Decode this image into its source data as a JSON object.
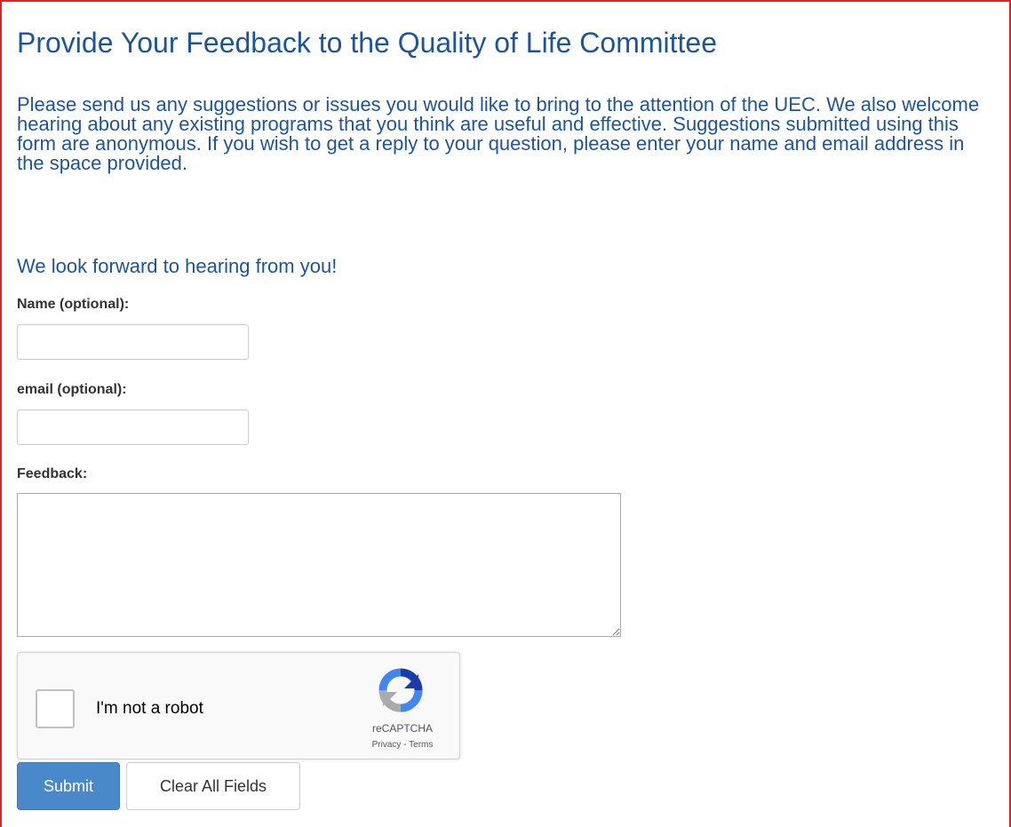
{
  "page": {
    "title": "Provide Your Feedback to the Quality of Life Committee",
    "intro": "Please send us any suggestions or issues you would like to bring to the attention of the UEC. We also welcome hearing about any existing programs that you think are useful and effective. Suggestions submitted using this form are anonymous. If you wish to get a reply to your question, please enter your name and email address in the space provided.",
    "closing": "We look forward to hearing from you!"
  },
  "form": {
    "name_label": "Name (optional):",
    "name_value": "",
    "email_label": "email (optional):",
    "email_value": "",
    "feedback_label": "Feedback:",
    "feedback_value": ""
  },
  "captcha": {
    "label": "I'm not a robot",
    "checked": false,
    "brand": "reCAPTCHA",
    "privacy_label": "Privacy",
    "separator": " - ",
    "terms_label": "Terms",
    "logo_icon": "recaptcha-icon"
  },
  "buttons": {
    "submit_label": "Submit",
    "clear_label": "Clear All Fields"
  },
  "colors": {
    "heading": "#1e5597",
    "frame_border": "#d9252a",
    "primary_button": "#4a89c9",
    "label_text": "#333333"
  }
}
